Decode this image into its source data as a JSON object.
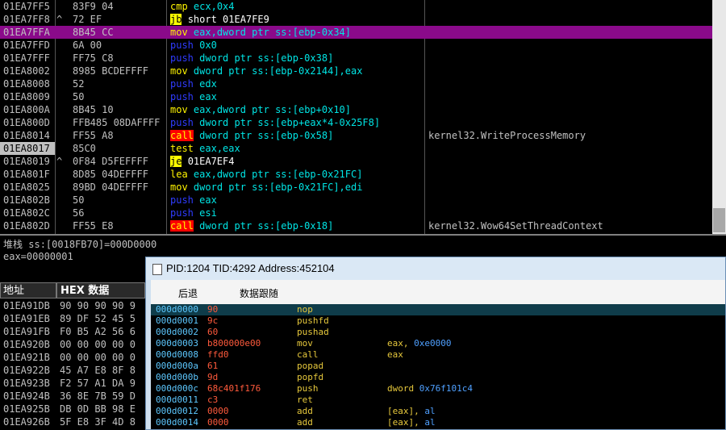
{
  "disasm": {
    "rows": [
      {
        "addr": "01EA7FF5",
        "jmp": "",
        "bytes": "83F9 04",
        "mn": "cmp",
        "ops": [
          {
            "t": "ecx,",
            "c": "y"
          },
          {
            "t": "0x4",
            "c": "y"
          }
        ],
        "comment": ""
      },
      {
        "addr": "01EA7FF8",
        "jmp": "^",
        "bytes": "72 EF",
        "mn": "jb",
        "ops": [
          {
            "t": "short 01EA7FE9",
            "c": "w"
          }
        ],
        "comment": ""
      },
      {
        "addr": "01EA7FFA",
        "jmp": "",
        "bytes": "8B45 CC",
        "mn": "mov",
        "ops": [
          {
            "t": "eax,dword ptr ss:[ebp-0x34]",
            "c": "y"
          }
        ],
        "comment": "",
        "sel": true
      },
      {
        "addr": "01EA7FFD",
        "jmp": "",
        "bytes": "6A 00",
        "mn": "push",
        "ops": [
          {
            "t": "0x0",
            "c": "y"
          }
        ],
        "comment": ""
      },
      {
        "addr": "01EA7FFF",
        "jmp": "",
        "bytes": "FF75 C8",
        "mn": "push",
        "ops": [
          {
            "t": "dword ptr ss:[ebp-0x38]",
            "c": "y"
          }
        ],
        "comment": ""
      },
      {
        "addr": "01EA8002",
        "jmp": "",
        "bytes": "8985 BCDEFFFF",
        "mn": "mov",
        "ops": [
          {
            "t": "dword ptr ss:[ebp-0x2144],eax",
            "c": "y"
          }
        ],
        "comment": ""
      },
      {
        "addr": "01EA8008",
        "jmp": "",
        "bytes": "52",
        "mn": "push",
        "ops": [
          {
            "t": "edx",
            "c": "y"
          }
        ],
        "comment": ""
      },
      {
        "addr": "01EA8009",
        "jmp": "",
        "bytes": "50",
        "mn": "push",
        "ops": [
          {
            "t": "eax",
            "c": "y"
          }
        ],
        "comment": ""
      },
      {
        "addr": "01EA800A",
        "jmp": "",
        "bytes": "8B45 10",
        "mn": "mov",
        "ops": [
          {
            "t": "eax,dword ptr ss:[ebp+0x10]",
            "c": "y"
          }
        ],
        "comment": ""
      },
      {
        "addr": "01EA800D",
        "jmp": "",
        "bytes": "FFB485 08DAFFFF",
        "mn": "push",
        "ops": [
          {
            "t": "dword ptr ss:[ebp+eax*4-0x25F8]",
            "c": "y"
          }
        ],
        "comment": ""
      },
      {
        "addr": "01EA8014",
        "jmp": "",
        "bytes": "FF55 A8",
        "mn": "call",
        "ops": [
          {
            "t": "dword ptr ss:[ebp-0x58]",
            "c": "y"
          }
        ],
        "comment": "kernel32.WriteProcessMemory"
      },
      {
        "addr": "01EA8017",
        "jmp": "",
        "bytes": "85C0",
        "mn": "test",
        "ops": [
          {
            "t": "eax,eax",
            "c": "y"
          }
        ],
        "comment": "",
        "cur": true
      },
      {
        "addr": "01EA8019",
        "jmp": "^",
        "bytes": "0F84 D5FEFFFF",
        "mn": "je",
        "ops": [
          {
            "t": "01EA7EF4",
            "c": "w"
          }
        ],
        "comment": ""
      },
      {
        "addr": "01EA801F",
        "jmp": "",
        "bytes": "8D85 04DEFFFF",
        "mn": "lea",
        "ops": [
          {
            "t": "eax,dword ptr ss:[ebp-0x21FC]",
            "c": "y"
          }
        ],
        "comment": ""
      },
      {
        "addr": "01EA8025",
        "jmp": "",
        "bytes": "89BD 04DEFFFF",
        "mn": "mov",
        "ops": [
          {
            "t": "dword ptr ss:[ebp-0x21FC],edi",
            "c": "y"
          }
        ],
        "comment": ""
      },
      {
        "addr": "01EA802B",
        "jmp": "",
        "bytes": "50",
        "mn": "push",
        "ops": [
          {
            "t": "eax",
            "c": "y"
          }
        ],
        "comment": ""
      },
      {
        "addr": "01EA802C",
        "jmp": "",
        "bytes": "56",
        "mn": "push",
        "ops": [
          {
            "t": "esi",
            "c": "y"
          }
        ],
        "comment": ""
      },
      {
        "addr": "01EA802D",
        "jmp": "",
        "bytes": "FF55 E8",
        "mn": "call",
        "ops": [
          {
            "t": "dword ptr ss:[ebp-0x18]",
            "c": "y"
          }
        ],
        "comment": "kernel32.Wow64SetThreadContext"
      }
    ]
  },
  "info": {
    "stack_label": "堆栈",
    "stack_text": " ss:[0018FB70]=000D0000",
    "eax_text": "eax=00000001"
  },
  "hex": {
    "addr_header": "地址",
    "data_header": "HEX 数据",
    "rows": [
      {
        "addr": "01EA91DB",
        "bytes": "90 90 90 90 9"
      },
      {
        "addr": "01EA91EB",
        "bytes": "89 DF 52 45 5"
      },
      {
        "addr": "01EA91FB",
        "bytes": "F0 B5 A2 56 6"
      },
      {
        "addr": "01EA920B",
        "bytes": "00 00 00 00 0"
      },
      {
        "addr": "01EA921B",
        "bytes": "00 00 00 00 0"
      },
      {
        "addr": "01EA922B",
        "bytes": "45 A7 E8 8F 8"
      },
      {
        "addr": "01EA923B",
        "bytes": "F2 57 A1 DA 9"
      },
      {
        "addr": "01EA924B",
        "bytes": "36 8E 7B 59 D"
      },
      {
        "addr": "01EA925B",
        "bytes": "DB 0D BB 98 E"
      },
      {
        "addr": "01EA926B",
        "bytes": "5F E8 3F 4D 8"
      }
    ]
  },
  "popup": {
    "title": "PID:1204  TID:4292  Address:452104",
    "back_label": "后退",
    "follow_label": "数据跟随",
    "rows": [
      {
        "addr": "000d0000",
        "bytes": "90",
        "mn": "nop",
        "op1": "",
        "op2": "",
        "sel": true
      },
      {
        "addr": "000d0001",
        "bytes": "9c",
        "mn": "pushfd",
        "op1": "",
        "op2": ""
      },
      {
        "addr": "000d0002",
        "bytes": "60",
        "mn": "pushad",
        "op1": "",
        "op2": ""
      },
      {
        "addr": "000d0003",
        "bytes": "b800000e00",
        "mn": "mov",
        "op1": "eax,",
        "op2": " 0xe0000"
      },
      {
        "addr": "000d0008",
        "bytes": "ffd0",
        "mn": "call",
        "op1": "eax",
        "op2": ""
      },
      {
        "addr": "000d000a",
        "bytes": "61",
        "mn": "popad",
        "op1": "",
        "op2": ""
      },
      {
        "addr": "000d000b",
        "bytes": "9d",
        "mn": "popfd",
        "op1": "",
        "op2": ""
      },
      {
        "addr": "000d000c",
        "bytes": "68c401f176",
        "mn": "push",
        "op1": "dword",
        "op2": " 0x76f101c4"
      },
      {
        "addr": "000d0011",
        "bytes": "c3",
        "mn": "ret",
        "op1": "",
        "op2": ""
      },
      {
        "addr": "000d0012",
        "bytes": "0000",
        "mn": "add",
        "op1": "[eax],",
        "op2": " al"
      },
      {
        "addr": "000d0014",
        "bytes": "0000",
        "mn": "add",
        "op1": "[eax],",
        "op2": " al"
      }
    ]
  }
}
